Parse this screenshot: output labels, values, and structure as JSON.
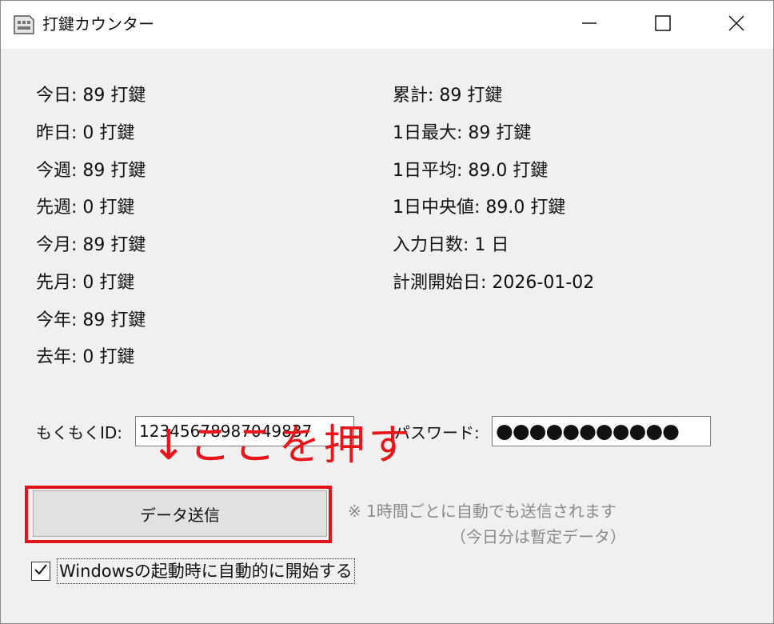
{
  "window": {
    "title": "打鍵カウンター"
  },
  "stats_left": [
    "今日: 89 打鍵",
    "昨日: 0 打鍵",
    "今週: 89 打鍵",
    "先週: 0 打鍵",
    "今月: 89 打鍵",
    "先月: 0 打鍵",
    "今年: 89 打鍵",
    "去年: 0 打鍵"
  ],
  "stats_right": [
    "累計: 89 打鍵",
    "1日最大: 89 打鍵",
    "1日平均: 89.0 打鍵",
    "1日中央値: 89.0 打鍵",
    "入力日数: 1 日",
    "計測開始日: 2026-01-02"
  ],
  "form": {
    "id_label": "もくもくID:",
    "id_value": "12345678987049837",
    "password_label": "パスワード:",
    "password_value": "●●●●●●●●●●●"
  },
  "annotation": {
    "text": "↓ここを押す",
    "color": "#e8151b"
  },
  "send_button": {
    "label": "データ送信"
  },
  "note": {
    "line1": "※ 1時間ごとに自動でも送信されます",
    "line2": "（今日分は暫定データ）"
  },
  "autostart": {
    "label": "Windowsの起動時に自動的に開始する",
    "checked": true
  },
  "icons": {
    "app": "keyboard-app-icon",
    "minimize": "minimize-icon",
    "maximize": "maximize-icon",
    "close": "close-icon",
    "check": "checkmark-icon"
  }
}
